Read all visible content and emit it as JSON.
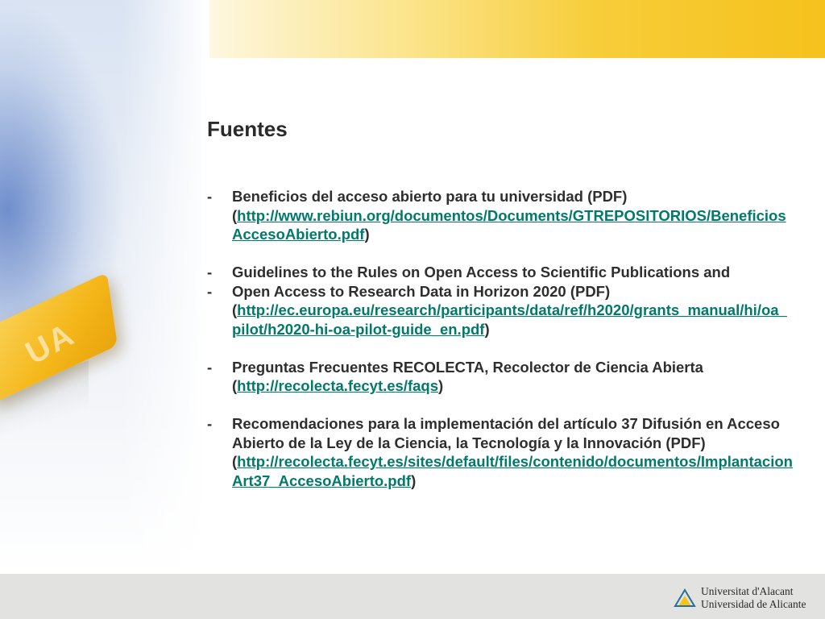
{
  "title": "Fuentes",
  "items": [
    {
      "dash": "-",
      "text": "Beneficios del acceso abierto para tu universidad (PDF)",
      "open": "(",
      "link": "http://www.rebiun.org/documentos/Documents/GTREPOSITORIOS/BeneficiosAccesoAbierto.pdf",
      "close": ")"
    },
    {
      "dash": "-",
      "text": "Guidelines to the Rules on Open Access to Scientific Publications and"
    },
    {
      "dash": "-",
      "text": "Open Access to Research Data in Horizon 2020 (PDF)",
      "open": "(",
      "link": "http://ec.europa.eu/research/participants/data/ref/h2020/grants_manual/hi/oa_pilot/h2020-hi-oa-pilot-guide_en.pdf",
      "close": ")"
    },
    {
      "dash": "-",
      "text": "Preguntas Frecuentes RECOLECTA, Recolector de Ciencia Abierta",
      "open": "(",
      "link": "http://recolecta.fecyt.es/faqs",
      "close": ")"
    },
    {
      "dash": "-",
      "text": "Recomendaciones para la implementación del artículo 37 Difusión en Acceso Abierto de la Ley de la Ciencia, la Tecnología y la Innovación (PDF)",
      "open": "(",
      "link": "http://recolecta.fecyt.es/sites/default/files/contenido/documentos/ImplantacionArt37_AccesoAbierto.pdf",
      "close": ")"
    }
  ],
  "decor": {
    "key_label": "UA"
  },
  "footer": {
    "line1": "Universitat d'Alacant",
    "line2": "Universidad de Alicante"
  },
  "colors": {
    "link": "#007a6a",
    "accent": "#f6c21c",
    "footer_bg": "#e2e2e0"
  }
}
